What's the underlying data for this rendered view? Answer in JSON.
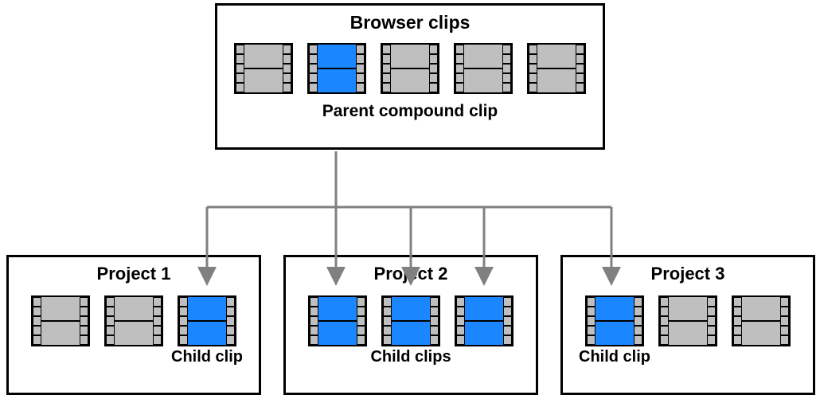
{
  "browser": {
    "title": "Browser clips",
    "sub_label": "Parent compound clip",
    "clips": [
      "gray",
      "blue",
      "gray",
      "gray",
      "gray"
    ]
  },
  "projects": [
    {
      "title": "Project 1",
      "sub_label": "Child clip",
      "clips": [
        "gray",
        "gray",
        "blue"
      ]
    },
    {
      "title": "Project 2",
      "sub_label": "Child clips",
      "clips": [
        "blue",
        "blue",
        "blue"
      ]
    },
    {
      "title": "Project 3",
      "sub_label": "Child clip",
      "clips": [
        "blue",
        "gray",
        "gray"
      ]
    }
  ],
  "colors": {
    "gray": "#bfbfbf",
    "blue": "#1a86ff",
    "arrow": "#808080"
  }
}
